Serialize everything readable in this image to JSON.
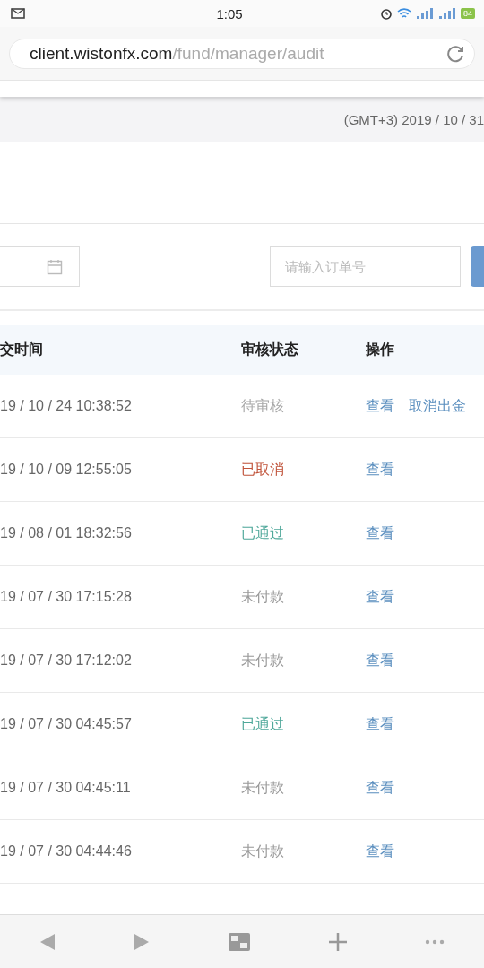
{
  "status_bar": {
    "time": "1:05",
    "battery": "84"
  },
  "address_bar": {
    "host": "client.wistonfx.com",
    "path": "/fund/manager/audit"
  },
  "timezone_banner": "(GMT+3) 2019 / 10 / 31",
  "filters": {
    "order_search": {
      "placeholder": "请输入订单号"
    }
  },
  "table": {
    "columns": [
      "交时间",
      "审核状态",
      "操作"
    ],
    "rows": [
      {
        "time": "19 / 10 / 24 10:38:52",
        "status": "待审核",
        "kind": "pending",
        "actions": [
          "查看",
          "取消出金"
        ]
      },
      {
        "time": "19 / 10 / 09 12:55:05",
        "status": "已取消",
        "kind": "cancelled",
        "actions": [
          "查看"
        ]
      },
      {
        "time": "19 / 08 / 01 18:32:56",
        "status": "已通过",
        "kind": "approved",
        "actions": [
          "查看"
        ]
      },
      {
        "time": "19 / 07 / 30 17:15:28",
        "status": "未付款",
        "kind": "unpaid",
        "actions": [
          "查看"
        ]
      },
      {
        "time": "19 / 07 / 30 17:12:02",
        "status": "未付款",
        "kind": "unpaid",
        "actions": [
          "查看"
        ]
      },
      {
        "time": "19 / 07 / 30 04:45:57",
        "status": "已通过",
        "kind": "approved",
        "actions": [
          "查看"
        ]
      },
      {
        "time": "19 / 07 / 30 04:45:11",
        "status": "未付款",
        "kind": "unpaid",
        "actions": [
          "查看"
        ]
      },
      {
        "time": "19 / 07 / 30 04:44:46",
        "status": "未付款",
        "kind": "unpaid",
        "actions": [
          "查看"
        ]
      }
    ]
  }
}
